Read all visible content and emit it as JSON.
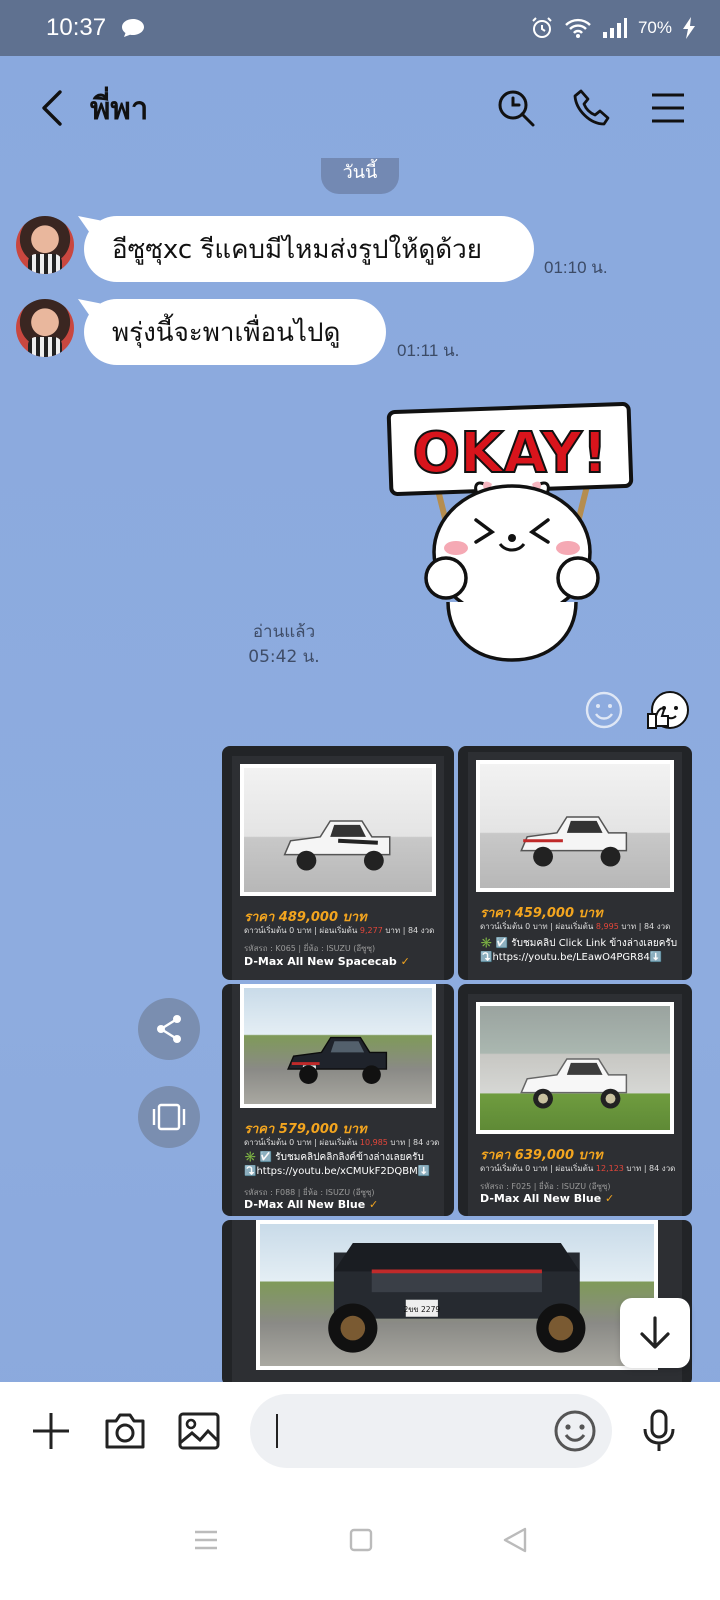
{
  "status_bar": {
    "time": "10:37",
    "battery": "70%"
  },
  "header": {
    "title": "พี่พา"
  },
  "chat": {
    "date_label": "วันนี้",
    "messages": [
      {
        "text": "อีซูซุxc รีแคบมีไหมส่งรูปให้ดูด้วย",
        "time": "01:10 น."
      },
      {
        "text": "พรุ่งนี้จะพาเพื่อนไปดู",
        "time": "01:11 น."
      }
    ],
    "sticker_text": "OKAY!",
    "read_label": "อ่านแล้ว",
    "read_time": "05:42 น."
  },
  "media_cards": [
    {
      "price": "ราคา 489,000 บาท",
      "installment_prefix": "ดาวน์เริ่มต้น 0 บาท | ผ่อนเริ่มต้น ",
      "installment_value": "9,277",
      "installment_suffix": " บาท | 84 งวด",
      "meta": "รหัสรถ : K065 | ยี่ห้อ : ISUZU (อีซูซุ)",
      "model": "D-Max All New Spacecab"
    },
    {
      "price": "ราคา 459,000 บาท",
      "installment_prefix": "ดาวน์เริ่มต้น 0 บาท | ผ่อนเริ่มต้น ",
      "installment_value": "8,995",
      "installment_suffix": " บาท | 84 งวด",
      "line1": "✳️ ☑️ รับชมคลิป Click Link ข้างล่างเลยครับ",
      "line2": "⤵️https://youtu.be/LEawO4PGR84⬇️"
    },
    {
      "price": "ราคา 579,000 บาท",
      "installment_prefix": "ดาวน์เริ่มต้น 0 บาท | ผ่อนเริ่มต้น ",
      "installment_value": "10,985",
      "installment_suffix": " บาท | 84 งวด",
      "line1": "✳️ ☑️ รับชมคลิปคลิกลิงค์ข้างล่างเลยครับ",
      "line2": "⤵️https://youtu.be/xCMUkF2DQBM⬇️",
      "meta": "รหัสรถ : F088 | ยี่ห้อ : ISUZU (อีซูซุ)",
      "model": "D-Max All New Blue"
    },
    {
      "price": "ราคา 639,000 บาท",
      "installment_prefix": "ดาวน์เริ่มต้น 0 บาท | ผ่อนเริ่มต้น ",
      "installment_value": "12,123",
      "installment_suffix": " บาท | 84 งวด",
      "meta": "รหัสรถ : F025 | ยี่ห้อ : ISUZU (อีซูซุ)",
      "model": "D-Max All New Blue"
    },
    {
      "plate": "2ขข 2279"
    }
  ],
  "colors": {
    "background": "#8eacdf",
    "status_bar": "#5f7190",
    "price": "#f3a51f",
    "card": "#222427"
  }
}
